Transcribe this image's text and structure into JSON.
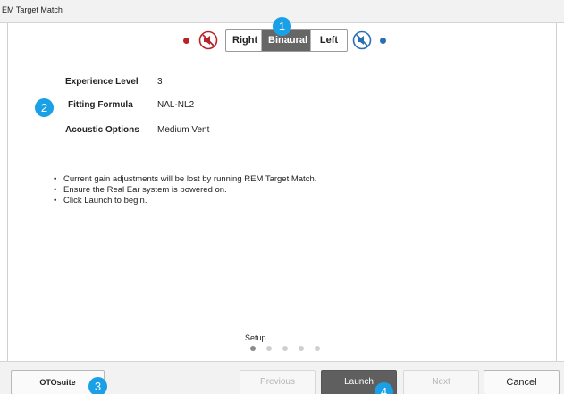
{
  "window": {
    "title": "EM Target Match"
  },
  "side_selector": {
    "left_ear_color": "#b8232a",
    "right_ear_color": "#2a6fb4",
    "options": [
      {
        "label": "Right",
        "active": false
      },
      {
        "label": "Binaural",
        "active": true
      },
      {
        "label": "Left",
        "active": false
      }
    ],
    "left_icon": "speaker-muted-red-icon",
    "right_icon": "speaker-muted-blue-icon"
  },
  "settings": [
    {
      "label": "Experience Level",
      "value": "3"
    },
    {
      "label": "Fitting Formula",
      "value": "NAL-NL2"
    },
    {
      "label": "Acoustic Options",
      "value": "Medium Vent"
    }
  ],
  "notes": [
    "Current gain adjustments will be lost by running REM Target Match.",
    "Ensure the Real Ear system is powered on.",
    "Click Launch to begin."
  ],
  "wizard": {
    "step_label": "Setup",
    "step_count": 5,
    "current_step": 1
  },
  "footer": {
    "otosuite_label": "OTOsuite",
    "previous_label": "Previous",
    "launch_label": "Launch",
    "next_label": "Next",
    "cancel_label": "Cancel"
  },
  "callouts": [
    "1",
    "2",
    "3",
    "4"
  ],
  "accent_color": "#1aa0e6"
}
